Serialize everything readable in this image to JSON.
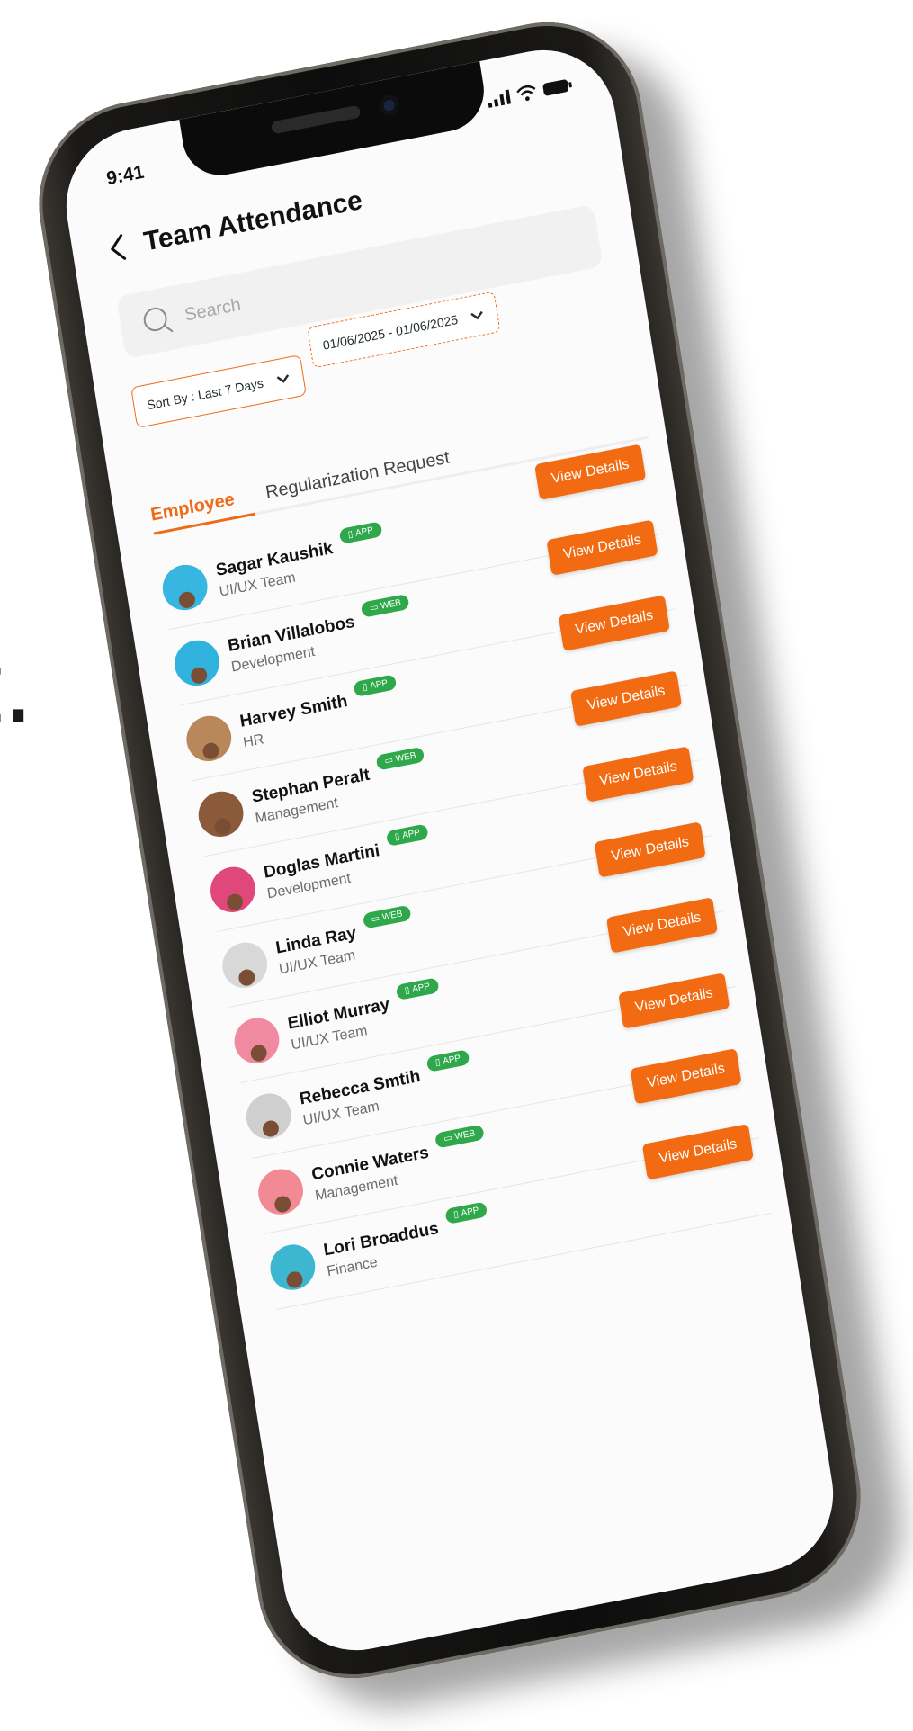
{
  "background_text": "t.",
  "status": {
    "time": "9:41"
  },
  "header": {
    "title": "Team Attendance"
  },
  "search": {
    "placeholder": "Search"
  },
  "filters": {
    "sort_label": "Sort By : Last 7 Days",
    "date_range": "01/06/2025 - 01/06/2025"
  },
  "tabs": [
    {
      "label": "Employee",
      "active": true
    },
    {
      "label": "Regularization Request",
      "active": false
    }
  ],
  "colors": {
    "accent": "#f26b12",
    "badge": "#2ea84a"
  },
  "employees": [
    {
      "name": "Sagar Kaushik",
      "dept": "UI/UX Team",
      "badge": "APP",
      "badge_icon": "phone-icon",
      "action": "View Details",
      "avatar_bg": "#36b6e0"
    },
    {
      "name": "Brian Villalobos",
      "dept": "Development",
      "badge": "WEB",
      "badge_icon": "monitor-icon",
      "action": "View Details",
      "avatar_bg": "#2fb2de"
    },
    {
      "name": "Harvey Smith",
      "dept": "HR",
      "badge": "APP",
      "badge_icon": "phone-icon",
      "action": "View Details",
      "avatar_bg": "#b8875a"
    },
    {
      "name": "Stephan Peralt",
      "dept": "Management",
      "badge": "WEB",
      "badge_icon": "monitor-icon",
      "action": "View Details",
      "avatar_bg": "#8a5a3b"
    },
    {
      "name": "Doglas Martini",
      "dept": "Development",
      "badge": "APP",
      "badge_icon": "phone-icon",
      "action": "View Details",
      "avatar_bg": "#e0477a"
    },
    {
      "name": "Linda Ray",
      "dept": "UI/UX Team",
      "badge": "WEB",
      "badge_icon": "monitor-icon",
      "action": "View Details",
      "avatar_bg": "#d8d8d8"
    },
    {
      "name": "Elliot Murray",
      "dept": "UI/UX Team",
      "badge": "APP",
      "badge_icon": "phone-icon",
      "action": "View Details",
      "avatar_bg": "#f08aa0"
    },
    {
      "name": "Rebecca Smtih",
      "dept": "UI/UX Team",
      "badge": "APP",
      "badge_icon": "phone-icon",
      "action": "View Details",
      "avatar_bg": "#cfcfcf"
    },
    {
      "name": "Connie Waters",
      "dept": "Management",
      "badge": "WEB",
      "badge_icon": "monitor-icon",
      "action": "View Details",
      "avatar_bg": "#f28a95"
    },
    {
      "name": "Lori Broaddus",
      "dept": "Finance",
      "badge": "APP",
      "badge_icon": "phone-icon",
      "action": "View Details",
      "avatar_bg": "#3cb7cf"
    }
  ]
}
